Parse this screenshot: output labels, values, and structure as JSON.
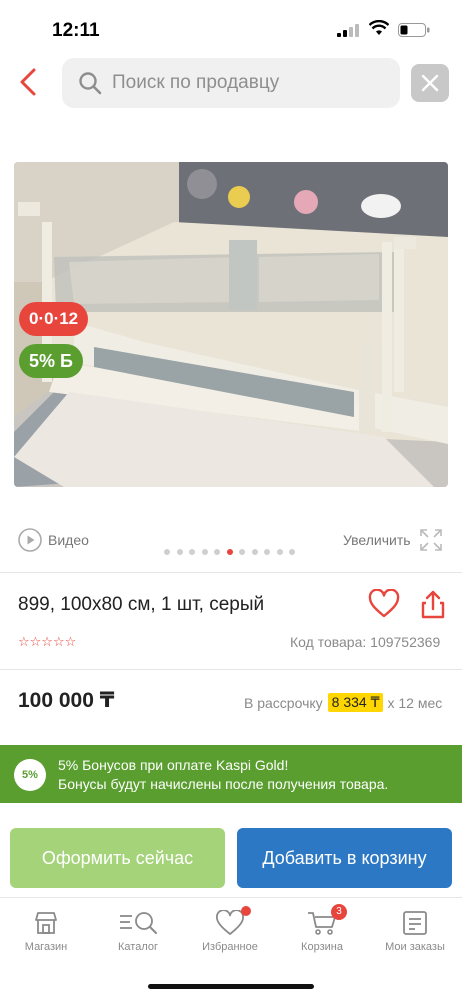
{
  "status_bar": {
    "time": "12:11"
  },
  "search": {
    "placeholder": "Поиск по продавцу"
  },
  "product_image": {
    "timer_badge": "0·0·12",
    "bonus_badge": "5% Б"
  },
  "gallery": {
    "video_label": "Видео",
    "zoom_label": "Увеличить",
    "dots_count": 11,
    "active_dot": 5
  },
  "product": {
    "title": "899, 100х80 см, 1 шт, серый",
    "rating_stars": "☆☆☆☆☆",
    "sku": "Код товара: 109752369",
    "price": "100 000 ₸",
    "installment_prefix": "В рассрочку",
    "installment_amount": "8 334 ₸",
    "installment_suffix": "х 12 мес"
  },
  "bonus_banner": {
    "badge": "5%",
    "line1": "5% Бонусов при оплате Kaspi Gold!",
    "line2": "Бонусы будут начислены после получения товара."
  },
  "actions": {
    "buy_now": "Оформить сейчас",
    "add_to_cart": "Добавить в корзину"
  },
  "tabbar": {
    "items": [
      {
        "label": "Магазин",
        "icon": "shop-icon"
      },
      {
        "label": "Каталог",
        "icon": "catalog-icon"
      },
      {
        "label": "Избранное",
        "icon": "heart-icon"
      },
      {
        "label": "Корзина",
        "icon": "cart-icon",
        "count": "3"
      },
      {
        "label": "Мои заказы",
        "icon": "orders-icon"
      }
    ]
  },
  "colors": {
    "accent": "#e8453c",
    "green": "#5a9e2f",
    "buy_button": "#a5d37a",
    "cart_button": "#2c78c4",
    "installment_highlight": "#ffd600"
  }
}
